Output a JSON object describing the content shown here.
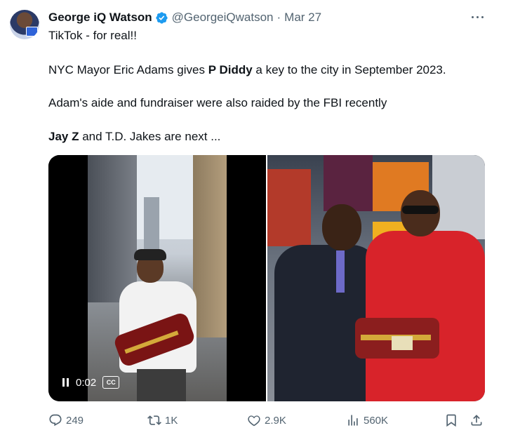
{
  "author": {
    "display_name": "George iQ Watson",
    "handle": "@GeorgeiQwatson",
    "separator": "·",
    "date": "Mar 27"
  },
  "tweet": {
    "line1": "TikTok - for real!!",
    "line2_prefix": "NYC Mayor Eric Adams gives ",
    "line2_bold": "P Diddy",
    "line2_suffix": " a key to the city in September 2023.",
    "line3": "Adam's aide and fundraiser were also raided by the FBI recently",
    "line4_bold": "Jay Z",
    "line4_suffix": " and T.D. Jakes are next ..."
  },
  "media": {
    "video_time": "0:02",
    "cc_label": "CC"
  },
  "actions": {
    "replies": "249",
    "reposts": "1K",
    "likes": "2.9K",
    "views": "560K"
  },
  "colors": {
    "text": "#0f1419",
    "secondary": "#536471",
    "verified": "#1d9bf0"
  },
  "icons": [
    "verified-badge-icon",
    "more-icon",
    "pause-icon",
    "closed-captions-icon",
    "reply-icon",
    "repost-icon",
    "like-icon",
    "views-icon",
    "bookmark-icon",
    "share-icon"
  ]
}
